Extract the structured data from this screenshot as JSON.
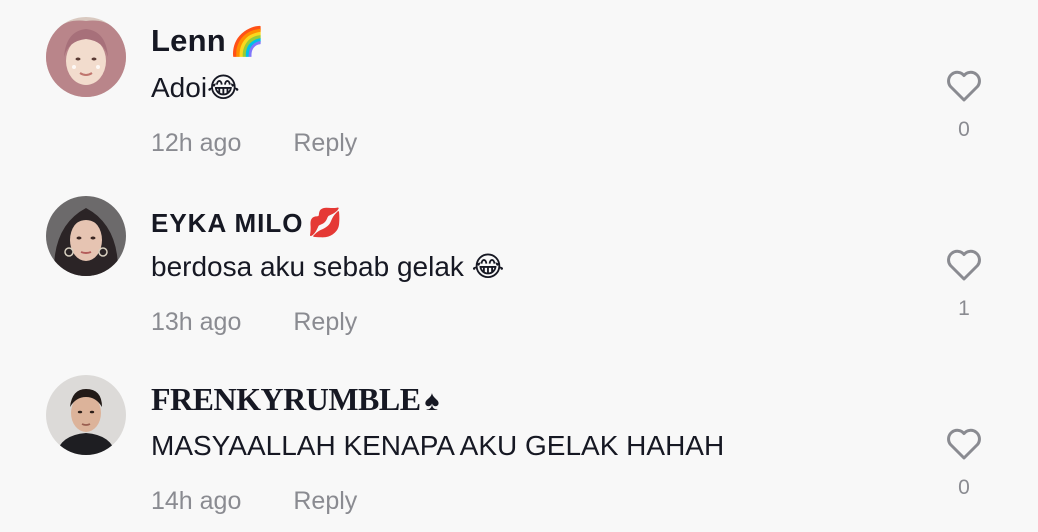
{
  "comments": [
    {
      "username": "Lenn",
      "flair": "🌈",
      "text": "Adoi😂",
      "time": "12h ago",
      "reply_label": "Reply",
      "like_count": "0",
      "avatar_icon": "hijab-woman-avatar"
    },
    {
      "username": "EYKA MILO",
      "flair": "💋",
      "text": "berdosa aku sebab gelak 😂",
      "time": "13h ago",
      "reply_label": "Reply",
      "like_count": "1",
      "avatar_icon": "woman-avatar"
    },
    {
      "username": "FRENKYRUMBLE",
      "flair": "♠",
      "text": "MASYAALLAH KENAPA AKU GELAK HAHAH",
      "time": "14h ago",
      "reply_label": "Reply",
      "like_count": "0",
      "avatar_icon": "man-avatar"
    }
  ],
  "colors": {
    "background": "#f8f8f8",
    "text": "#161823",
    "muted": "#8a8b91"
  }
}
